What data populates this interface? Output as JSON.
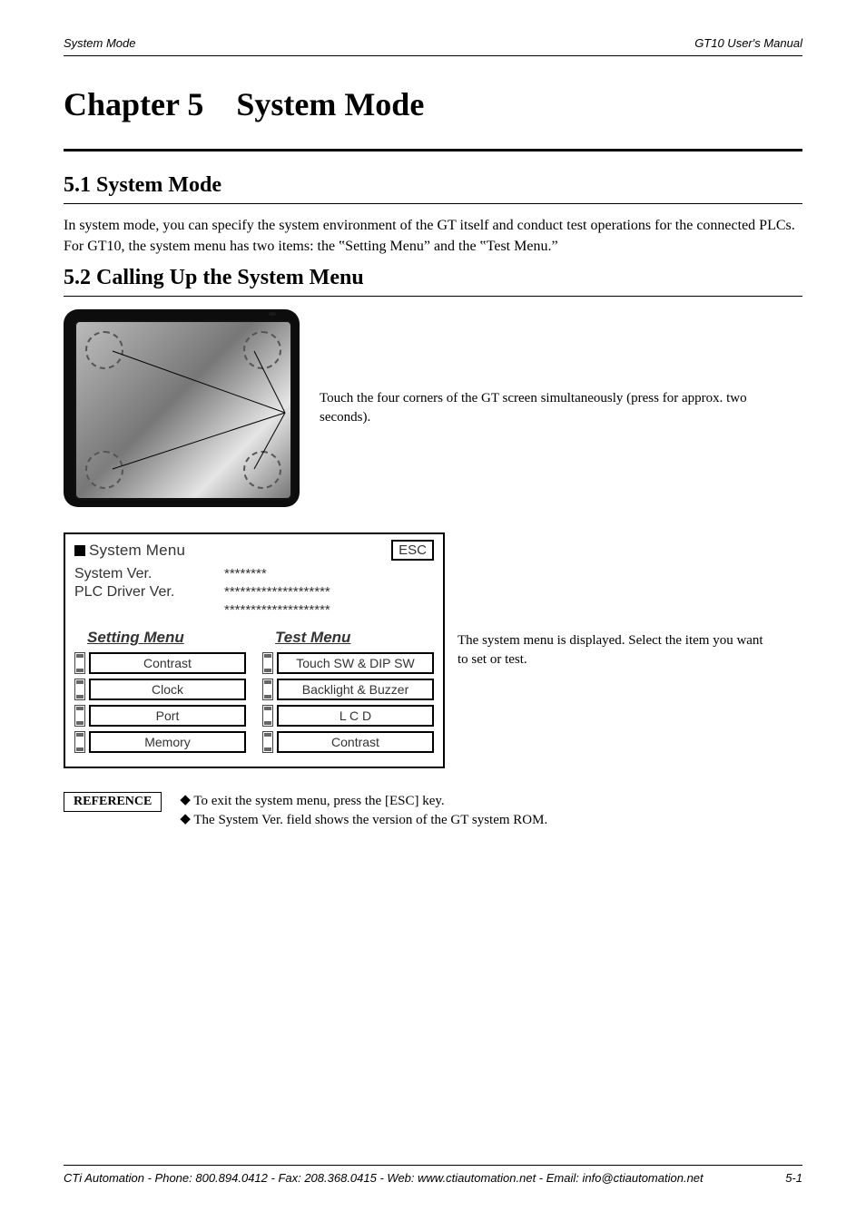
{
  "header": {
    "left": "System Mode",
    "right": "GT10 User's Manual"
  },
  "chapter": {
    "number": "Chapter 5",
    "title": "System Mode"
  },
  "section_51": {
    "heading": "5.1 System Mode",
    "para": "In system mode, you can specify the system environment of the GT itself and conduct test operations for the connected PLCs. For GT10, the system menu has two items: the ‟Setting Menu” and the ‟Test Menu.”"
  },
  "section_52": {
    "heading": "5.2 Calling Up the System Menu",
    "device_caption": "Touch the four corners of the GT screen simultaneously (press for approx. two seconds).",
    "screenshot_caption": "The system menu is displayed. Select the item you want to set or test.",
    "system_menu": {
      "title": "System Menu",
      "esc_label": "ESC",
      "system_ver_label": "System Ver.",
      "system_ver_value": "********",
      "plc_driver_ver_label": "PLC Driver Ver.",
      "plc_driver_ver_value1": "********************",
      "plc_driver_ver_value2": "********************",
      "setting_menu": {
        "title": "Setting Menu",
        "items": [
          "Contrast",
          "Clock",
          "Port",
          "Memory"
        ]
      },
      "test_menu": {
        "title": "Test Menu",
        "items": [
          "Touch SW & DIP SW",
          "Backlight & Buzzer",
          "L C D",
          "Contrast"
        ]
      }
    }
  },
  "callout": {
    "label": "REFERENCE",
    "lines": [
      "To exit the system menu, press the [ESC] key.",
      "The System Ver. field shows the version of the GT system ROM."
    ]
  },
  "footer": {
    "left": "CTi Automation - Phone: 800.894.0412 - Fax: 208.368.0415 - Web: www.ctiautomation.net - Email: info@ctiautomation.net",
    "right": "5-1"
  }
}
